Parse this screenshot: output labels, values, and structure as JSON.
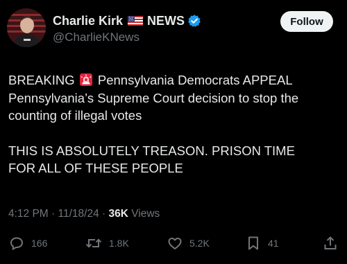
{
  "author": {
    "display_name": "Charlie Kirk",
    "news_label": "NEWS",
    "handle": "@CharlieKNews",
    "verified_color": "#1d9bf0"
  },
  "follow_label": "Follow",
  "post": {
    "breaking": "BREAKING",
    "line1_rest": "Pennsylvania Democrats APPEAL",
    "line2": "Pennsylvania’s Supreme Court decision to stop the",
    "line3": "counting of illegal votes",
    "line4": "THIS IS ABSOLUTELY TREASON. PRISON TIME",
    "line5": "FOR ALL OF THESE PEOPLE"
  },
  "meta": {
    "time": "4:12 PM",
    "sep1": " · ",
    "date": "11/18/24",
    "sep2": " · ",
    "views_count": "36K",
    "views_label": " Views"
  },
  "actions": {
    "replies": "166",
    "reposts": "1.8K",
    "likes": "5.2K",
    "bookmarks": "41"
  },
  "icons": {
    "flag": "us-flag-icon",
    "verified": "verified-badge-icon",
    "siren": "police-siren-icon",
    "reply": "reply-icon",
    "repost": "repost-icon",
    "like": "heart-icon",
    "bookmark": "bookmark-icon",
    "share": "share-icon"
  }
}
